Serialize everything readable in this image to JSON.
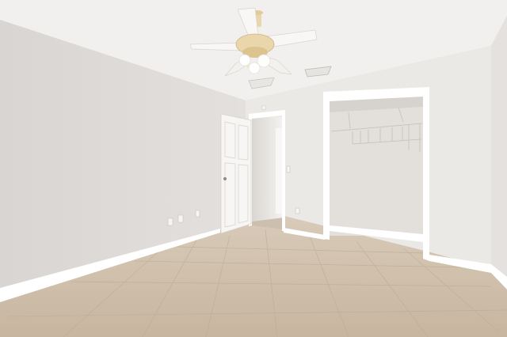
{
  "scene": {
    "kind": "empty bedroom interior",
    "colors": {
      "ceiling": "#f1f0ee",
      "wall_left": "#dedbd8",
      "wall_back": "#ebe9e6",
      "wall_right": "#e4e1de",
      "floor": "#cfc0ac",
      "trim": "#ffffff",
      "door": "#f7f6f4",
      "closet_interior": "#e3e0dc",
      "fan_brass": "#e9d6aa"
    }
  }
}
